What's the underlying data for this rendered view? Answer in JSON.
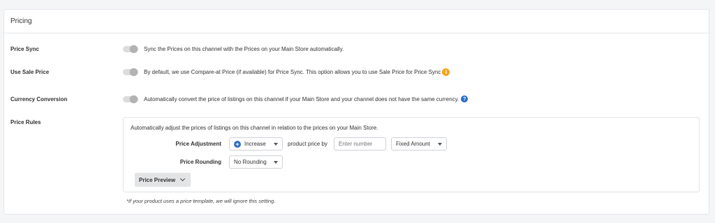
{
  "section": {
    "title": "Pricing"
  },
  "price_sync": {
    "label": "Price Sync",
    "description": "Sync the Prices on this channel with the Prices on your Main Store automatically.",
    "enabled": false
  },
  "use_sale_price": {
    "label": "Use Sale Price",
    "description": "By default, we use Compare-at Price (if available) for Price Sync. This option allows you to use Sale Price for Price Sync",
    "enabled": false,
    "icon": "info-icon"
  },
  "currency_conversion": {
    "label": "Currency Conversion",
    "description": "Automatically convert the price of listings on this channel if your Main Store and your channel does not have the same currency.",
    "enabled": false,
    "icon": "help-icon"
  },
  "price_rules": {
    "label": "Price Rules",
    "intro": "Automatically adjust the prices of listings on this channel in relation to the prices on your Main Store.",
    "adjustment": {
      "label": "Price Adjustment",
      "direction_value": "Increase",
      "connector_text": "product price by",
      "amount_placeholder": "Enter number",
      "type_value": "Fixed Amount"
    },
    "rounding": {
      "label": "Price Rounding",
      "value": "No Rounding"
    },
    "preview_button": "Price Preview"
  },
  "footnote": "*If your product uses a price template, we will ignore this setting.",
  "colors": {
    "info_icon": "#f5a623",
    "help_icon": "#2f6fc8",
    "toggle_off_track": "#dcdcdc"
  }
}
